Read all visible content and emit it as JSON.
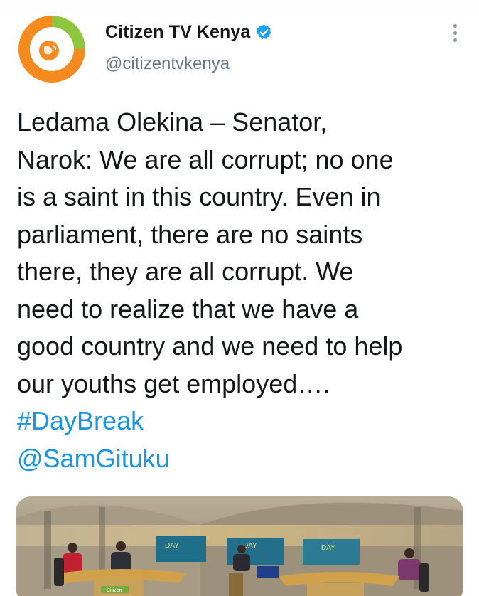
{
  "account": {
    "display_name": "Citizen TV Kenya",
    "handle": "@citizentvkenya",
    "verified": true,
    "brand_colors": {
      "orange": "#f58a1f",
      "green": "#8dc63f"
    }
  },
  "tweet": {
    "text_lines": [
      "Ledama Olekina – Senator,",
      "Narok: We are all corrupt; no one",
      "is a saint in this country. Even in",
      "parliament, there are no saints",
      "there, they are all corrupt. We",
      "need to realize that we have a",
      "good country and we need to help",
      "our youths get employed…."
    ],
    "hashtag": "#DayBreak",
    "mention": "@SamGituku"
  },
  "media": {
    "screen_labels": [
      "DAY",
      "DAY",
      "DAY"
    ],
    "desk_logo": "Citizen"
  },
  "icons": {
    "verified": "verified-badge-icon",
    "more": "more-vertical-icon"
  },
  "colors": {
    "link": "#1b95e0",
    "text": "#14171a",
    "secondary": "#657786",
    "verified": "#1da1f2"
  }
}
